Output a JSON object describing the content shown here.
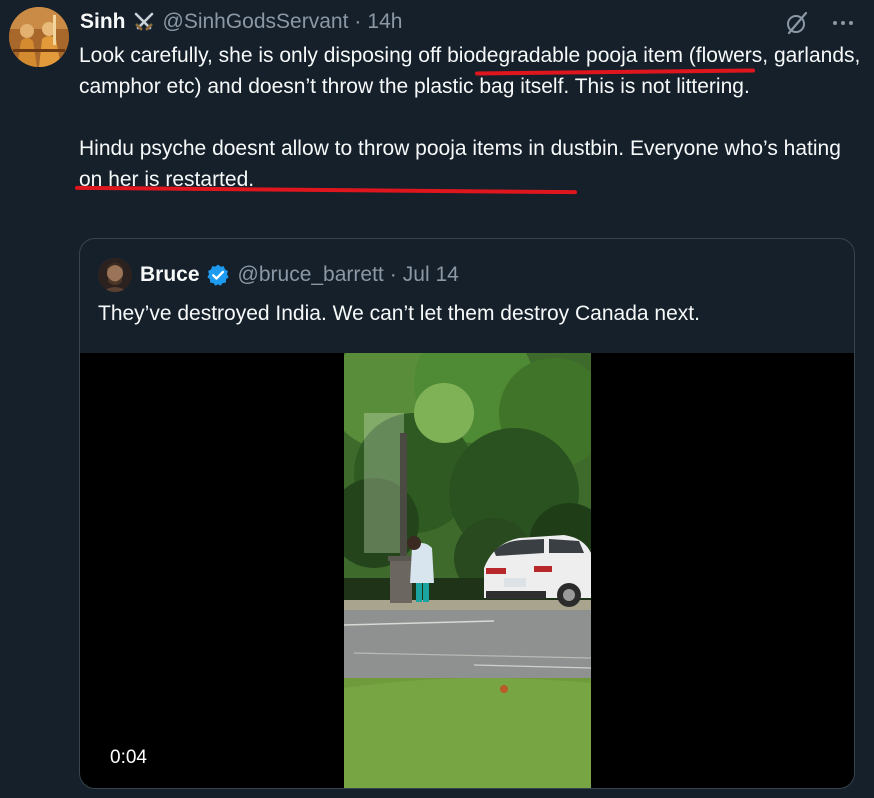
{
  "tweet": {
    "author_name": "Sinh",
    "author_handle": "@SinhGodsServant",
    "separator": "·",
    "time": "14h",
    "paragraph_1": "Look carefully, she is only disposing off biodegradable pooja item (flowers, garlands, camphor etc) and doesn’t throw the plastic bag itself. This is not littering.",
    "paragraph_2": "Hindu psyche doesnt allow to throw pooja items in dustbin. Everyone who’s hating on her is restarted.",
    "annotation_color": "#e0161e"
  },
  "top_icons": {
    "grok": "grok-slash-icon",
    "more": "more-horizontal-icon"
  },
  "quote": {
    "author_name": "Bruce",
    "author_handle": "@bruce_barrett",
    "separator": "·",
    "date": "Jul 14",
    "text": "They’ve destroyed India. We can’t let them destroy Canada next.",
    "verified_color": "#1d9bf0",
    "video": {
      "timestamp": "0:04"
    }
  },
  "colors": {
    "background": "#15202b",
    "text": "#f7f9f9",
    "muted": "#8b98a5",
    "border": "#38444d"
  }
}
